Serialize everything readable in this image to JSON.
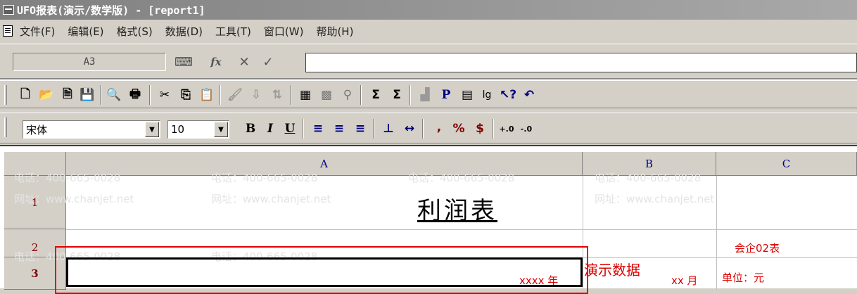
{
  "window": {
    "title": "UFO报表(演示/数学版) - [report1]"
  },
  "menu": {
    "items": [
      "文件(F)",
      "编辑(E)",
      "格式(S)",
      "数据(D)",
      "工具(T)",
      "窗口(W)",
      "帮助(H)"
    ]
  },
  "formula_bar": {
    "cell_name": "A3",
    "fx_label": "fx",
    "cancel_glyph": "✕",
    "confirm_glyph": "✓",
    "value": ""
  },
  "format_bar": {
    "font_name": "宋体",
    "font_size": "10",
    "bold": "B",
    "italic": "I",
    "underline": "U",
    "comma": ",",
    "percent": "%",
    "currency": "$",
    "dec_inc": "+.0",
    "dec_dec": "-.0",
    "bold_icon_p": "P",
    "log_label": "lg"
  },
  "columns": [
    "A",
    "B",
    "C"
  ],
  "rows": [
    "1",
    "2",
    "3"
  ],
  "cells": {
    "title": "利润表",
    "form_code": "会企02表",
    "unit": "单位：元",
    "year_placeholder": "xxxx 年",
    "month_placeholder": "xx 月",
    "demo_label": "演示数据"
  },
  "watermarks": {
    "phone": "电话：400-665-0028",
    "site": "网址：www.chanjet.net"
  },
  "colors": {
    "accent_red": "#dd0000",
    "column_header_text": "#000080",
    "row_header_text": "#800000"
  }
}
